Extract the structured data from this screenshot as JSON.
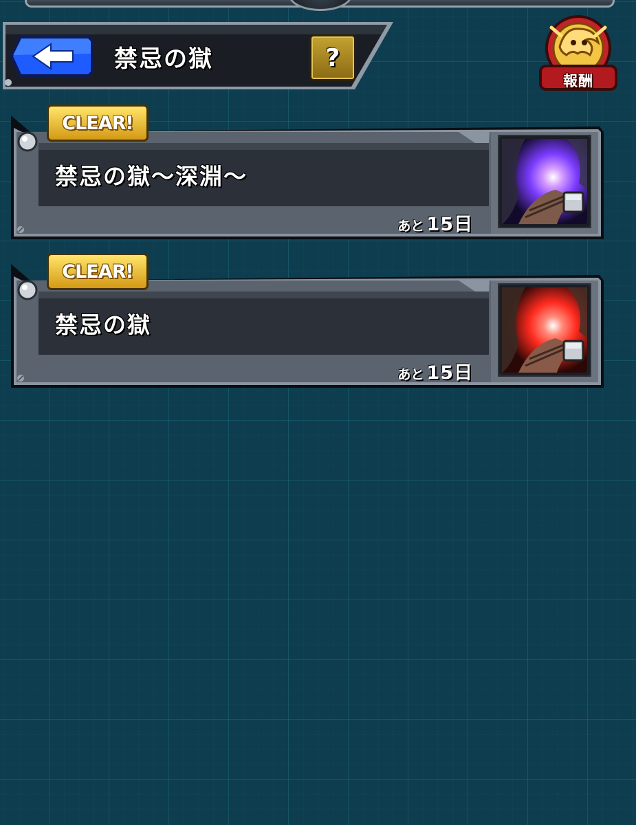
{
  "header": {
    "title": "禁忌の獄",
    "back_icon": "back-arrow-icon",
    "help_label": "?"
  },
  "reward": {
    "label": "報酬",
    "icon": "dragon-emblem-icon"
  },
  "quests": [
    {
      "badge": "CLEAR!",
      "title": "禁忌の獄〜深淵〜",
      "remaining_prefix": "あと",
      "remaining_value": "15日",
      "thumbnail": "abyss-cave-thumbnail",
      "accent": "#7b3cff"
    },
    {
      "badge": "CLEAR!",
      "title": "禁忌の獄",
      "remaining_prefix": "あと",
      "remaining_value": "15日",
      "thumbnail": "crimson-cave-thumbnail",
      "accent": "#ff2a1e"
    }
  ],
  "colors": {
    "background": "#0d3d4e",
    "gold": "#d39a16",
    "back_button_blue": "#1f5cff"
  }
}
